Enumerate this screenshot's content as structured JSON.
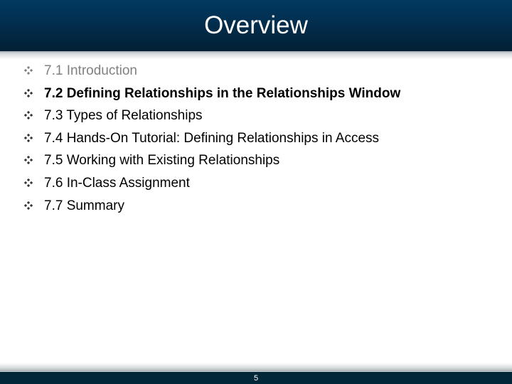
{
  "slide": {
    "title": "Overview",
    "page_number": "5",
    "colors": {
      "header_bg": "#022a47",
      "footer_bg": "#022739",
      "muted_text": "#808080",
      "text": "#000000"
    }
  },
  "bullet_icon": "four-diamond-bullet-icon",
  "items": [
    {
      "label": "7.1 Introduction",
      "style": "muted"
    },
    {
      "label": "7.2 Defining Relationships in the Relationships Window",
      "style": "bold"
    },
    {
      "label": "7.3 Types of Relationships",
      "style": "normal"
    },
    {
      "label": "7.4 Hands-On Tutorial: Defining Relationships in Access",
      "style": "normal"
    },
    {
      "label": "7.5 Working with Existing Relationships",
      "style": "normal"
    },
    {
      "label": "7.6 In-Class Assignment",
      "style": "normal"
    },
    {
      "label": "7.7 Summary",
      "style": "normal"
    }
  ]
}
